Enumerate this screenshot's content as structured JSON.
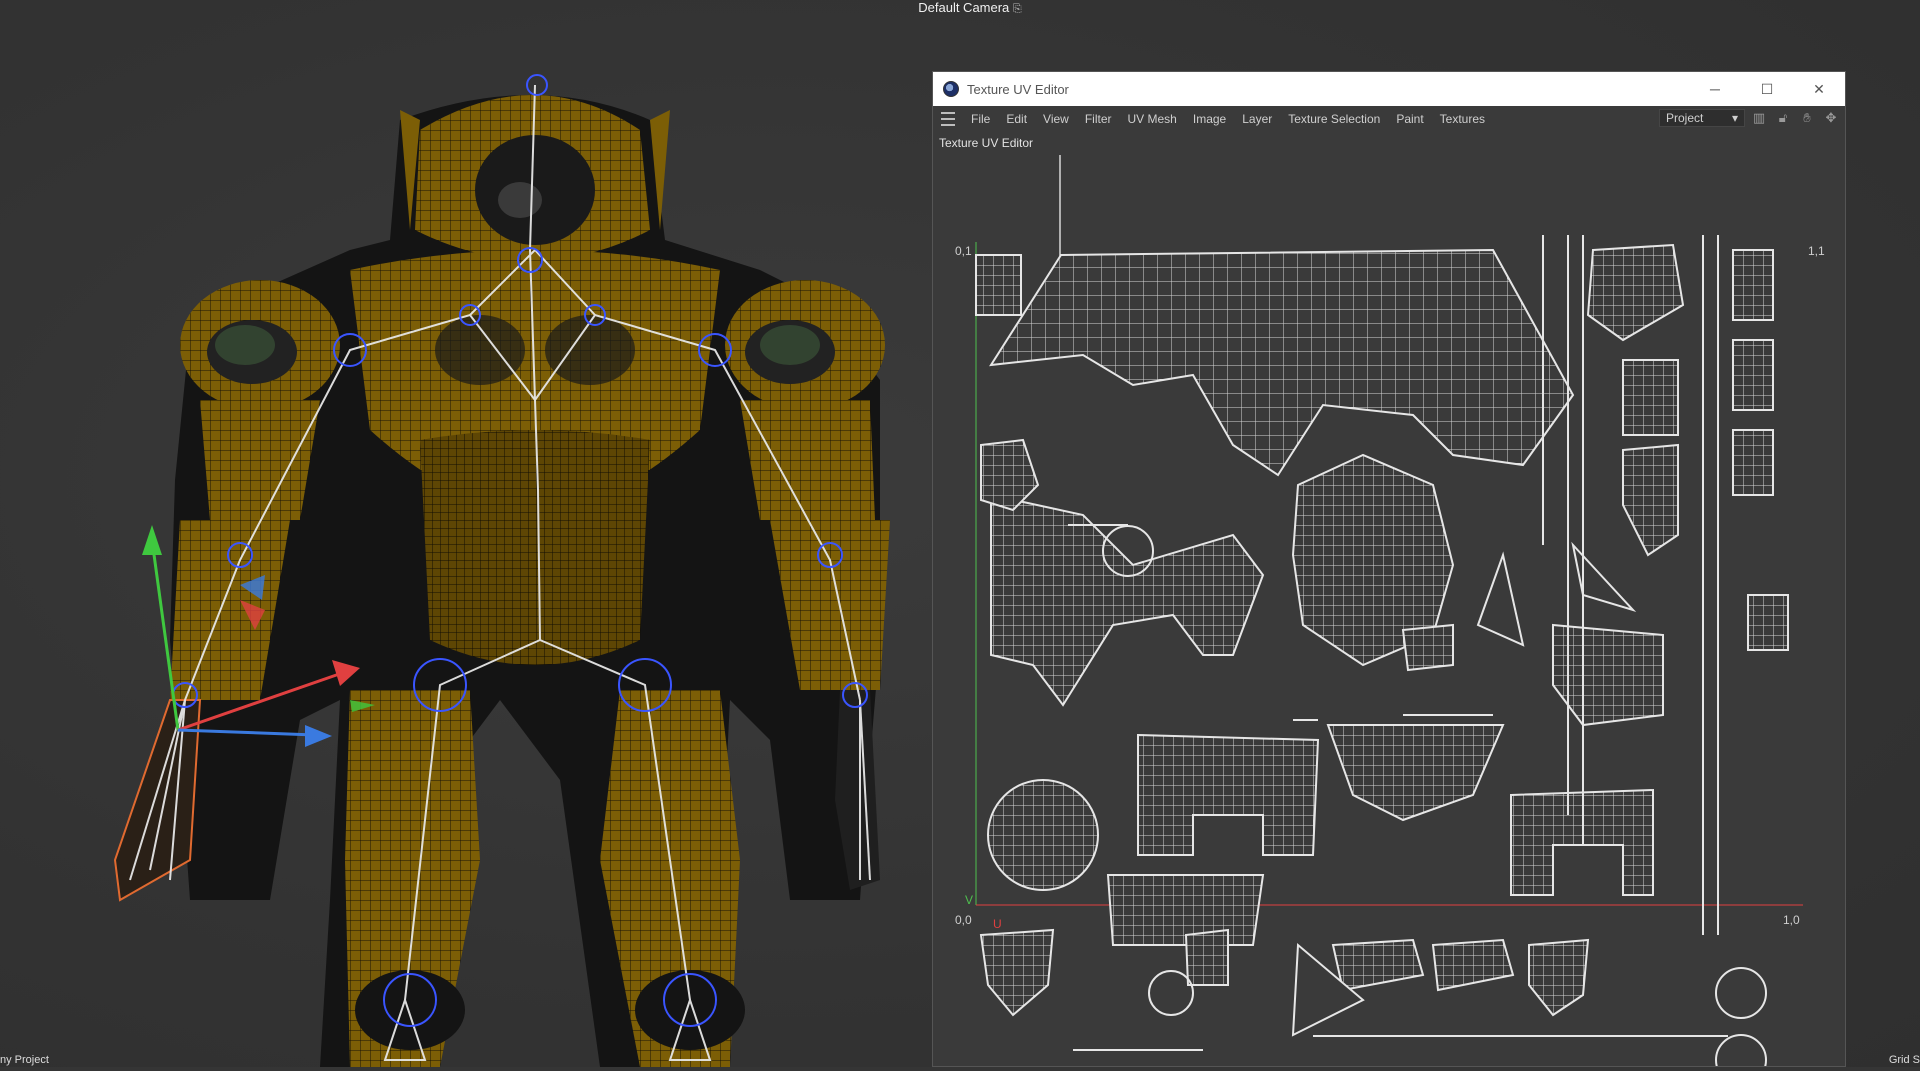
{
  "viewport": {
    "camera_label": "Default Camera",
    "camera_icon": "camera-icon",
    "footer_left": "ny Project",
    "footer_right": "Grid S"
  },
  "uv_window": {
    "title": "Texture UV Editor",
    "controls": {
      "minimize": "─",
      "maximize": "☐",
      "close": "✕"
    },
    "menu": [
      "File",
      "Edit",
      "View",
      "Filter",
      "UV Mesh",
      "Image",
      "Layer",
      "Texture Selection",
      "Paint",
      "Textures"
    ],
    "project_select": "Project",
    "panel_title": "Texture UV Editor",
    "labels": {
      "top_left": "0,1",
      "top_right": "1,1",
      "bottom_left": "0,0",
      "bottom_right": "1,0",
      "axis_u": "U",
      "axis_v": "V"
    }
  },
  "colors": {
    "accent_uv_red": "#e04040",
    "accent_uv_green": "#4fc04f",
    "robot_yellow": "#8a6a06",
    "bone_blue": "#3a55ff"
  }
}
